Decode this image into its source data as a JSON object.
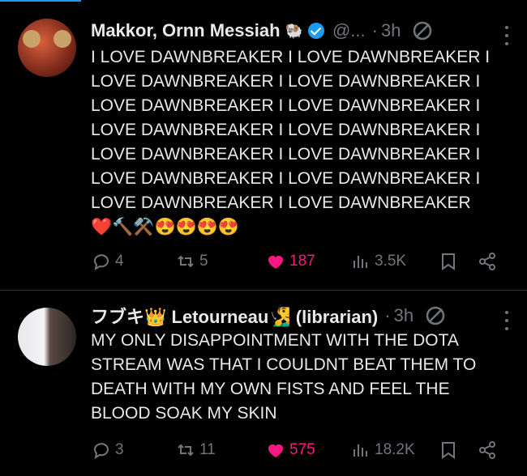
{
  "tweets": [
    {
      "name": "Makkor, Ornn Messiah",
      "name_emoji": "🐏",
      "handle": "@...",
      "time": "3h",
      "text_lines": [
        "I LOVE DAWNBREAKER I LOVE DAWNBREAKER I",
        "LOVE DAWNBREAKER I LOVE DAWNBREAKER I",
        "LOVE DAWNBREAKER I LOVE DAWNBREAKER I",
        "LOVE DAWNBREAKER I LOVE DAWNBREAKER I",
        "LOVE DAWNBREAKER I LOVE DAWNBREAKER I",
        "LOVE DAWNBREAKER I LOVE DAWNBREAKER I",
        "LOVE DAWNBREAKER I LOVE DAWNBREAKER",
        "❤️🔨⚒️😍😍😍😍"
      ],
      "replies": "4",
      "retweets": "5",
      "likes": "187",
      "views": "3.5K"
    },
    {
      "name": "フブキ👑 Letourneau🧏‍♂️ (librarian)",
      "handle": "",
      "time": "3h",
      "text_lines": [
        "MY ONLY DISAPPOINTMENT WITH THE DOTA",
        "STREAM WAS THAT I COULDNT BEAT THEM TO",
        "DEATH WITH MY OWN FISTS AND FEEL THE",
        "BLOOD SOAK MY SKIN"
      ],
      "replies": "3",
      "retweets": "11",
      "likes": "575",
      "views": "18.2K"
    }
  ],
  "colors": {
    "background": "#000000",
    "text": "#e7e9ea",
    "muted": "#71767b",
    "like": "#f91880",
    "verified": "#1d9bf0",
    "divider": "#2f3336"
  },
  "icons": [
    "verified-badge-icon",
    "no-sign-icon",
    "more-icon",
    "reply-icon",
    "retweet-icon",
    "heart-icon",
    "views-icon",
    "bookmark-icon",
    "share-icon"
  ]
}
